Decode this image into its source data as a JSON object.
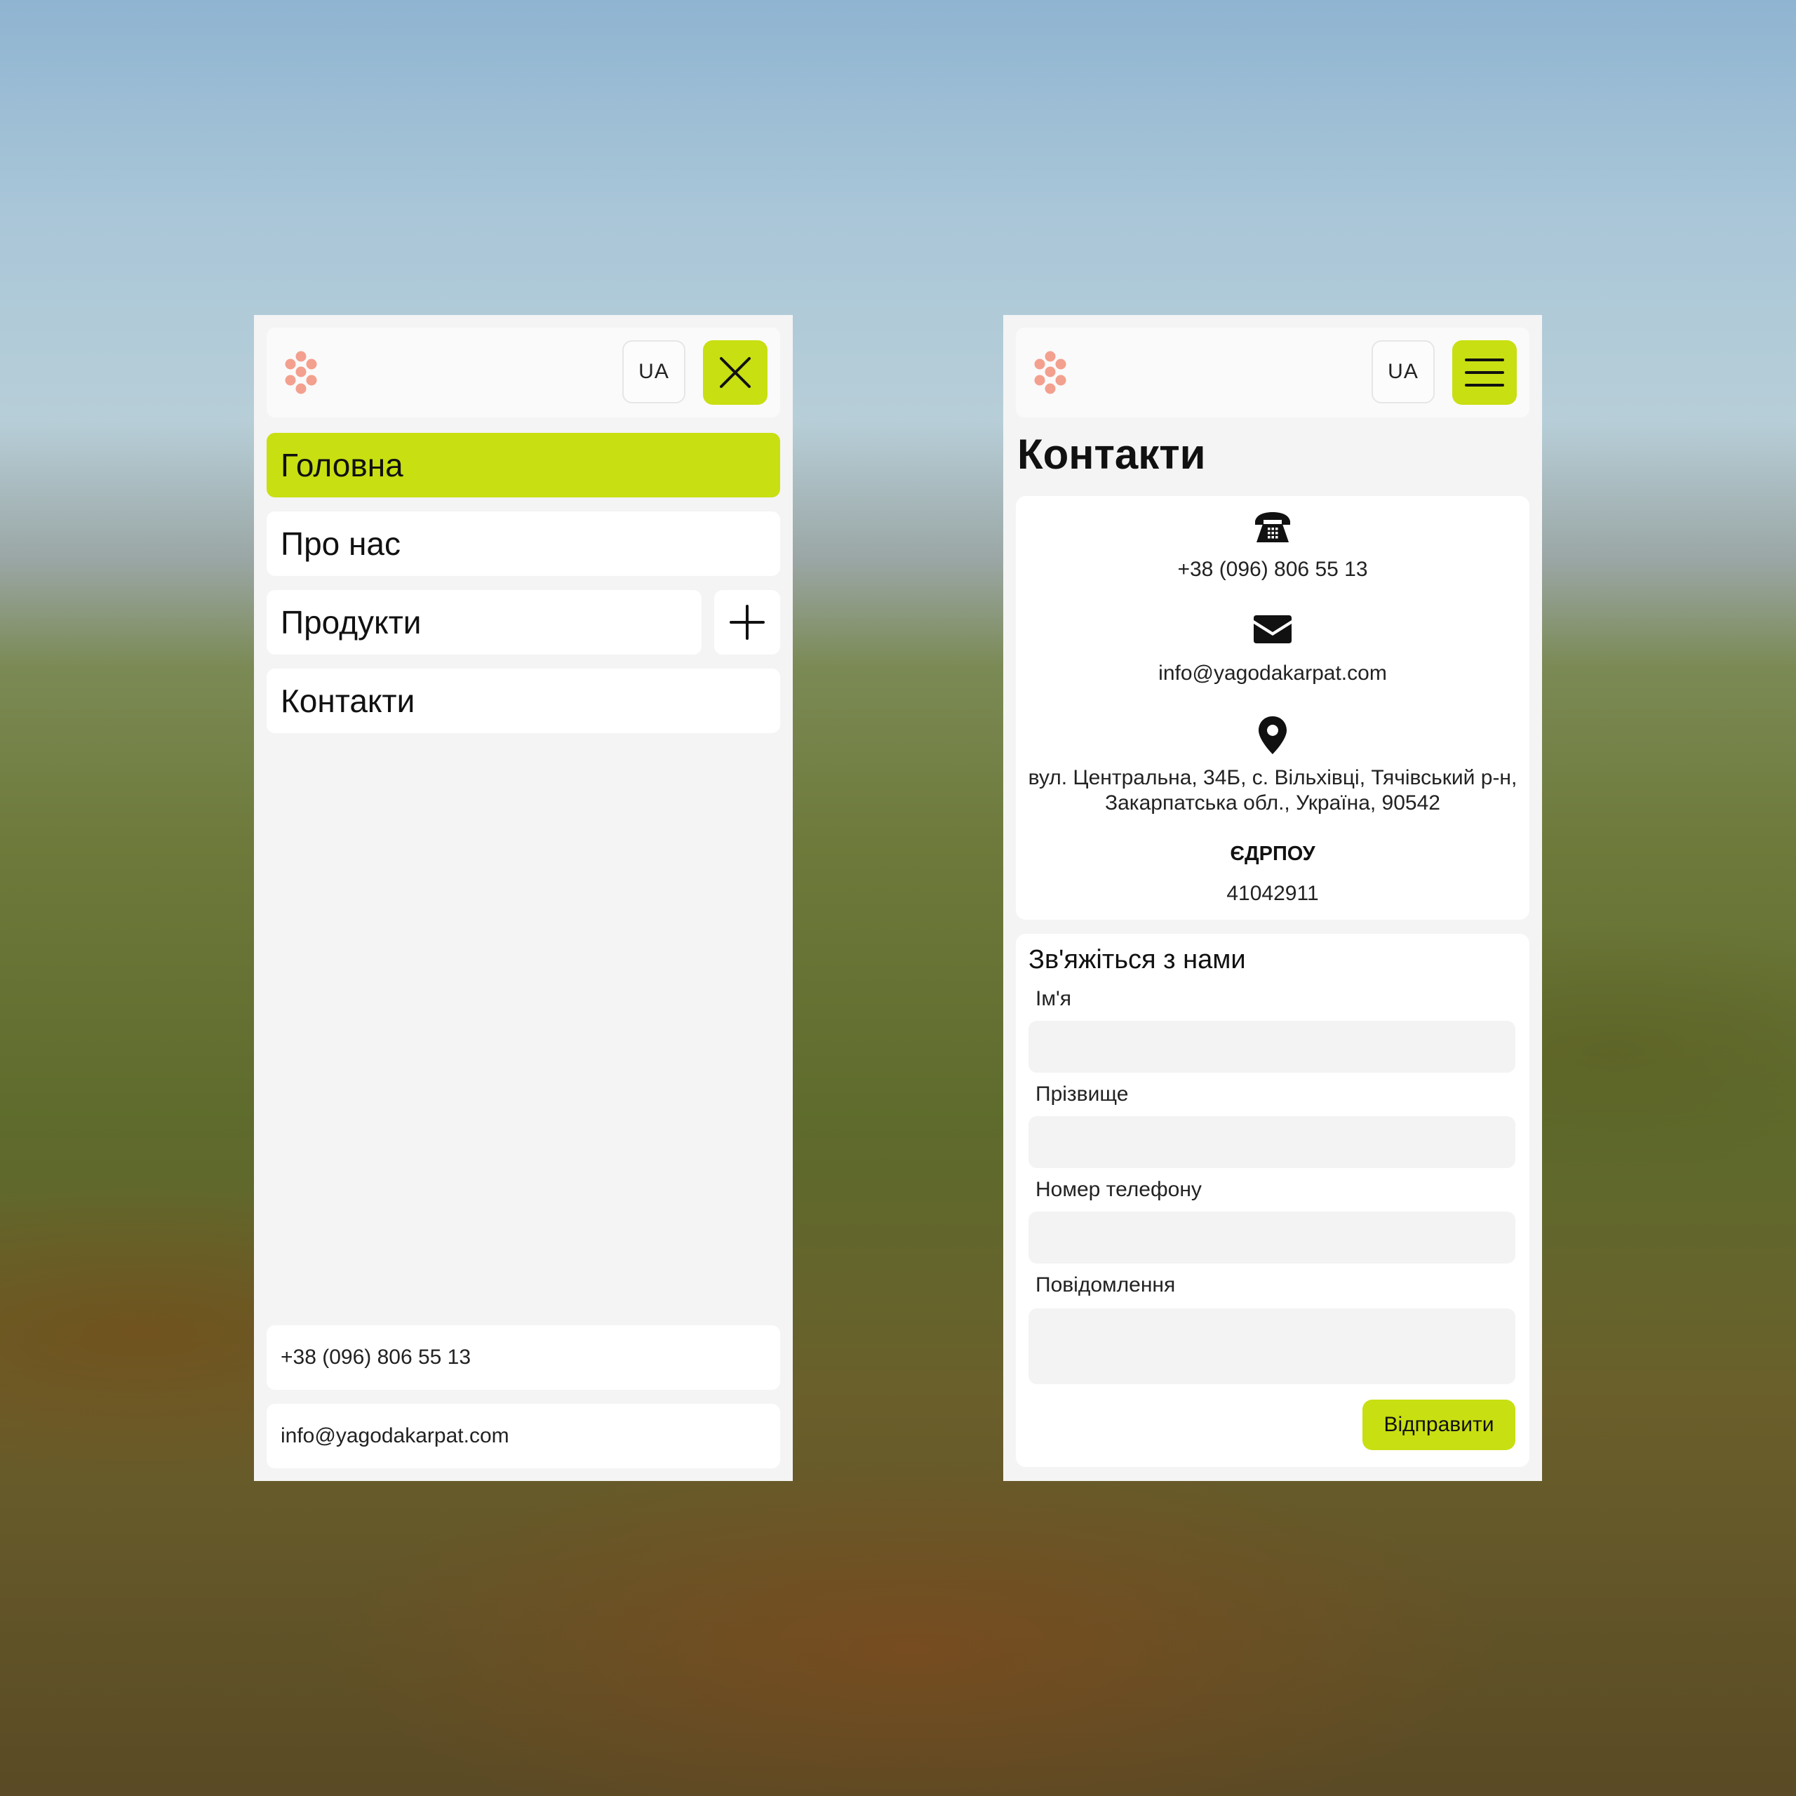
{
  "colors": {
    "accent": "#c8df12",
    "logo": "#f3a08f",
    "panel_bg": "#f4f4f4",
    "card_bg": "#ffffff"
  },
  "left_screen": {
    "lang_label": "UA",
    "close_icon": "close-icon",
    "nav": [
      {
        "label": "Головна",
        "active": true
      },
      {
        "label": "Про нас"
      },
      {
        "label": "Продукти",
        "expand_icon": "plus-icon"
      },
      {
        "label": "Контакти"
      }
    ],
    "footer": {
      "phone": "+38 (096) 806 55 13",
      "email": "info@yagodakarpat.com"
    }
  },
  "right_screen": {
    "lang_label": "UA",
    "menu_icon": "hamburger-icon",
    "title": "Контакти",
    "contacts": {
      "phone_icon": "phone-icon",
      "phone": "+38 (096) 806 55 13",
      "email_icon": "envelope-icon",
      "email": "info@yagodakarpat.com",
      "address_icon": "map-pin-icon",
      "address": "вул. Центральна, 34Б, с. Вільхівці, Тячівський р-н, Закарпатська обл., Україна, 90542",
      "edrpou_label": "ЄДРПОУ",
      "edrpou_value": "41042911"
    },
    "form": {
      "title": "Зв'яжіться з нами",
      "fields": [
        {
          "label": "Ім'я",
          "value": ""
        },
        {
          "label": "Прізвище",
          "value": ""
        },
        {
          "label": "Номер телефону",
          "value": ""
        },
        {
          "label": "Повідомлення",
          "value": ""
        }
      ],
      "submit_label": "Відправити"
    }
  }
}
